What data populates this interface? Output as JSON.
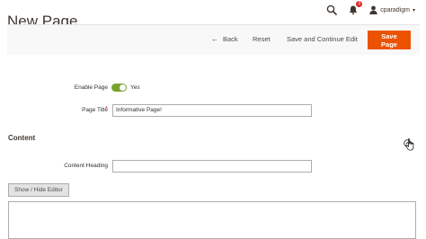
{
  "page": {
    "title": "New Page"
  },
  "header": {
    "search_icon": "search-icon",
    "notifications": {
      "icon": "bell-icon",
      "count": "3"
    },
    "user": {
      "icon": "user-icon",
      "name": "cparadigm"
    }
  },
  "actions": {
    "back_label": "Back",
    "reset_label": "Reset",
    "save_continue_label": "Save and Continue Edit",
    "save_label": "Save Page",
    "save_color": "#eb5202"
  },
  "form": {
    "enable": {
      "label": "Enable Page",
      "value": "Yes",
      "enabled": true,
      "toggle_color": "#79a22e"
    },
    "title": {
      "label": "Page Title",
      "required": "*",
      "value": "Informative Page!"
    }
  },
  "content_section": {
    "title": "Content",
    "heading": {
      "label": "Content Heading",
      "value": ""
    },
    "show_hide_label": "Show / Hide Editor"
  }
}
